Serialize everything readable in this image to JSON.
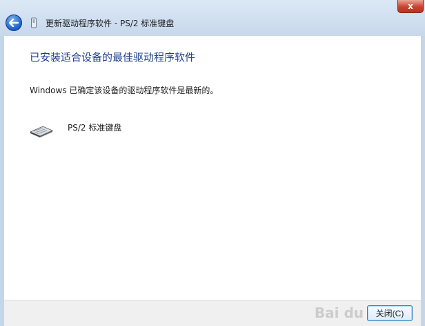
{
  "window": {
    "title": "更新驱动程序软件 - PS/2 标准键盘",
    "close_glyph": "x"
  },
  "main": {
    "heading": "已安装适合设备的最佳驱动程序软件",
    "message": "Windows 已确定该设备的驱动程序软件是最新的。",
    "device": {
      "name": "PS/2 标准键盘",
      "icon": "keyboard-icon"
    }
  },
  "footer": {
    "close_label": "关闭(C)",
    "watermark": "Bai du 经验"
  },
  "colors": {
    "heading": "#1d3e8f",
    "chrome": "#c4d6ea",
    "close_red": "#c8432f"
  }
}
